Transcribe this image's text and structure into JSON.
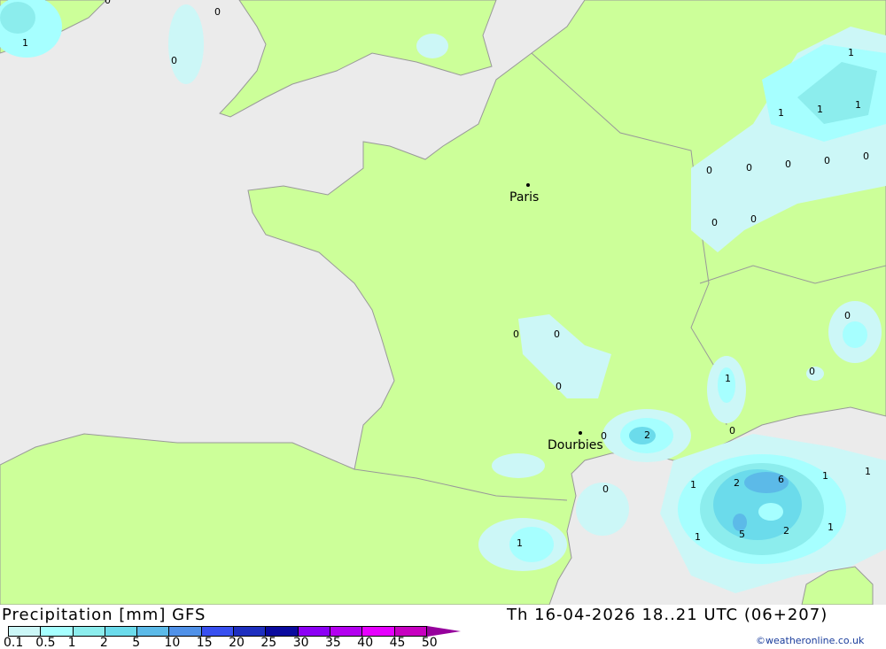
{
  "title": "Precipitation [mm] GFS",
  "datetime": "Th 16-04-2026 18..21 UTC (06+207)",
  "credit": "©weatheronline.co.uk",
  "colors": {
    "sea": "#ebebeb",
    "land": "#ccff99",
    "border": "#999999"
  },
  "legend": {
    "ticks": [
      "0.1",
      "0.5",
      "1",
      "2",
      "5",
      "10",
      "15",
      "20",
      "25",
      "30",
      "35",
      "40",
      "45",
      "50"
    ],
    "colors": [
      "#ccf7f7",
      "#a6ffff",
      "#8ceded",
      "#6bdbeb",
      "#5cbae8",
      "#5091e8",
      "#3850f0",
      "#1e2fbf",
      "#0a0a9e",
      "#8c00f5",
      "#b400f0",
      "#e600ff",
      "#c700c0",
      "#96009c"
    ]
  },
  "cities": [
    {
      "name": "Paris"
    },
    {
      "name": "Dourbies"
    }
  ],
  "values": [
    "0",
    "1",
    "0",
    "0",
    "1",
    "1",
    "1",
    "1",
    "0",
    "0",
    "0",
    "0",
    "0",
    "0",
    "0",
    "0",
    "0",
    "0",
    "0",
    "0",
    "1",
    "2",
    "0",
    "0",
    "1",
    "2",
    "6",
    "1",
    "1",
    "1",
    "5",
    "2",
    "1",
    "0",
    "1"
  ]
}
